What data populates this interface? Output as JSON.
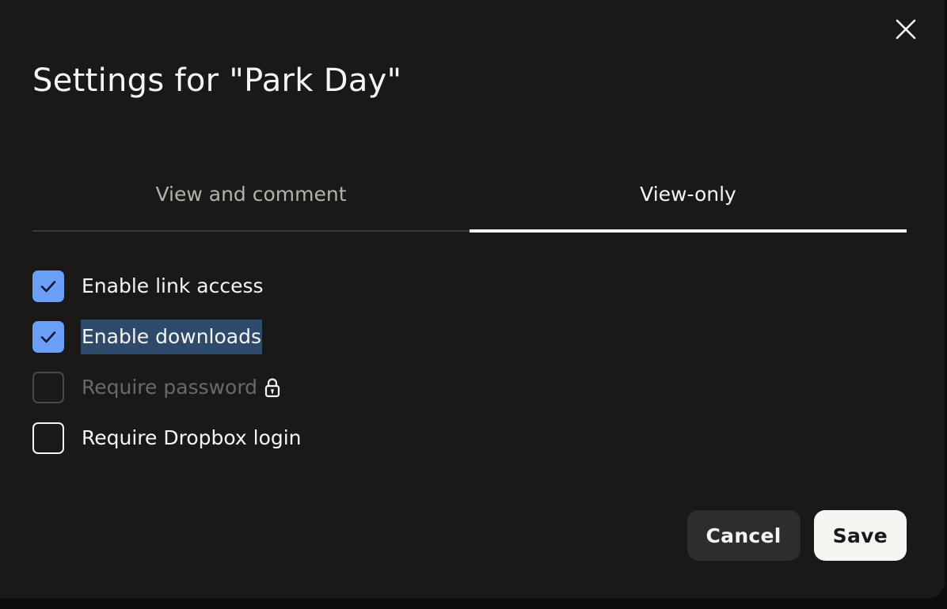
{
  "dialog": {
    "title": "Settings for \"Park Day\"",
    "close_icon": "close-icon"
  },
  "tabs": [
    {
      "label": "View and comment",
      "active": false
    },
    {
      "label": "View-only",
      "active": true
    }
  ],
  "options": [
    {
      "label": "Enable link access",
      "checked": true,
      "disabled": false,
      "highlighted": false
    },
    {
      "label": "Enable downloads",
      "checked": true,
      "disabled": false,
      "highlighted": true
    },
    {
      "label": "Require password",
      "checked": false,
      "disabled": true,
      "highlighted": false,
      "icon": "lock-icon"
    },
    {
      "label": "Require Dropbox login",
      "checked": false,
      "disabled": false,
      "highlighted": false
    }
  ],
  "actions": {
    "cancel_label": "Cancel",
    "save_label": "Save"
  },
  "colors": {
    "background": "#1a1918",
    "accent": "#6a9ef7",
    "text": "#f7f5f2",
    "selection": "#2d4a6b"
  }
}
